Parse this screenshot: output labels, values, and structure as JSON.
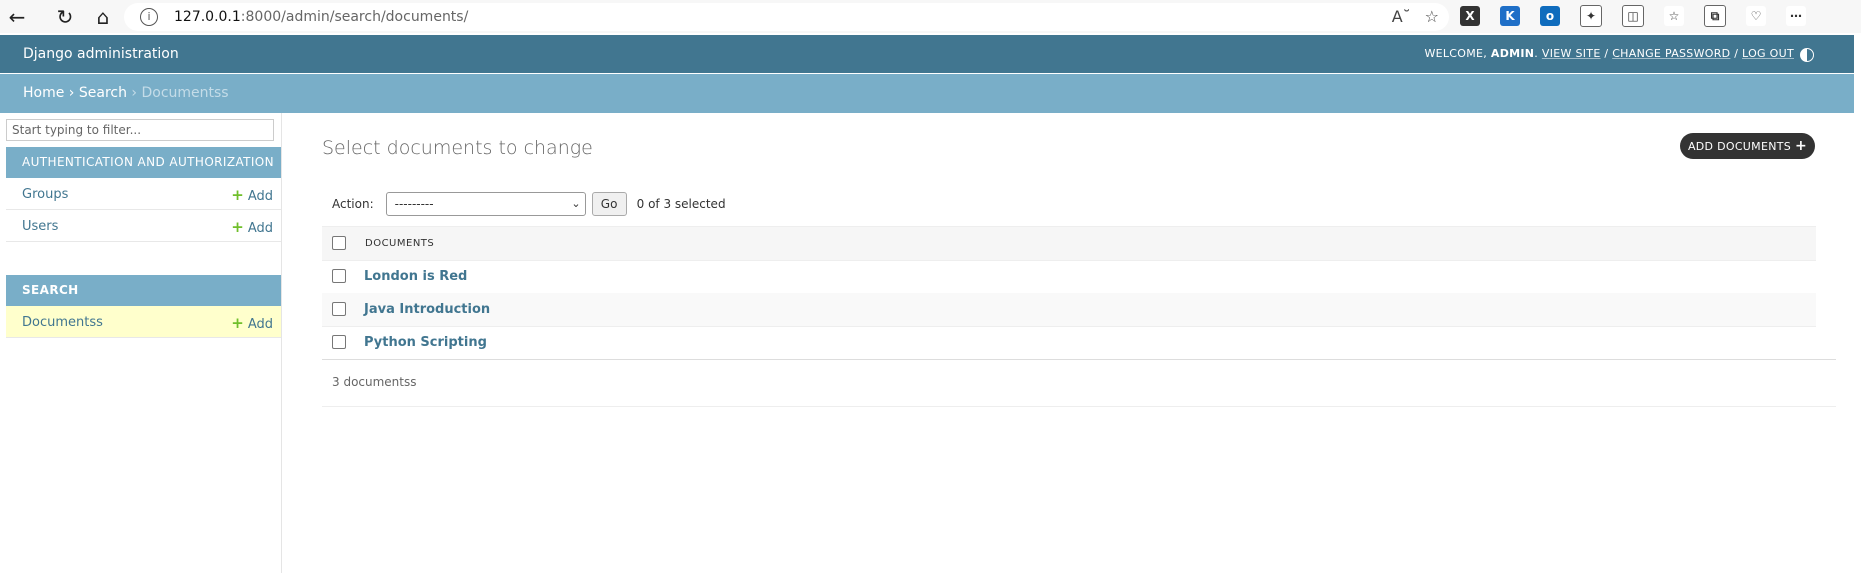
{
  "browser": {
    "url_host": "127.0.0.1",
    "url_rest": ":8000/admin/search/documents/"
  },
  "header": {
    "branding": "Django administration",
    "welcome": "WELCOME,",
    "username": "ADMIN",
    "view_site": "VIEW SITE",
    "change_password": "CHANGE PASSWORD",
    "log_out": "LOG OUT",
    "sep": "/"
  },
  "breadcrumbs": {
    "home": "Home",
    "app": "Search",
    "current": "Documentss",
    "sep": "›"
  },
  "sidebar": {
    "filter_placeholder": "Start typing to filter...",
    "add_label": "Add",
    "apps": [
      {
        "caption": "AUTHENTICATION AND AUTHORIZATION",
        "models": [
          "Groups",
          "Users"
        ]
      },
      {
        "caption": "SEARCH",
        "models": [
          "Documentss"
        ]
      }
    ]
  },
  "main": {
    "title": "Select documents to change",
    "add_button": "ADD DOCUMENTS",
    "action_label": "Action:",
    "action_selected": "---------",
    "go_label": "Go",
    "selected_count": "0 of 3 selected",
    "column_header": "DOCUMENTS",
    "rows": [
      "London is Red",
      "Java Introduction",
      "Python Scripting"
    ],
    "paginator": "3 documentss"
  },
  "colors": {
    "header": "#417690",
    "breadcrumbs": "#79aec8",
    "link": "#417690",
    "active_row": "#ffffcc",
    "add_plus": "#70bf2b"
  }
}
